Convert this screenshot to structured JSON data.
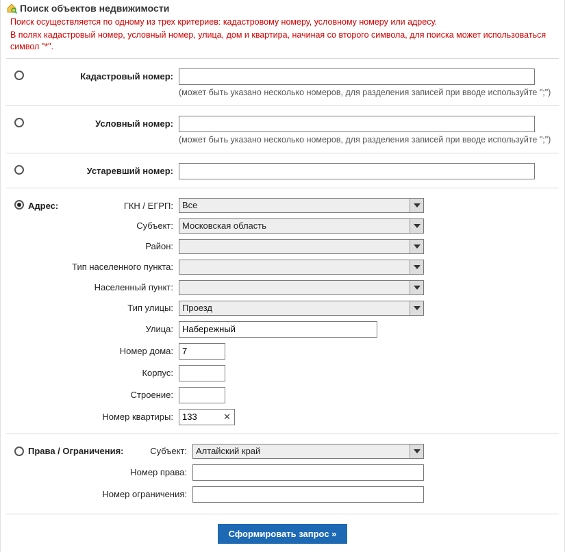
{
  "title": "Поиск объектов недвижимости",
  "note_line1": "Поиск осуществляется по одному из трех критериев: кадастровому номеру, условному номеру или адресу.",
  "note_line2": "В полях кадастровый номер, условный номер, улица, дом и квартира, начиная со второго символа, для поиска может использоваться символ \"*\".",
  "criteria": {
    "cadastral": {
      "label": "Кадастровый номер:",
      "value": "",
      "hint": "(может быть указано несколько номеров, для разделения записей при вводе используйте \";\")"
    },
    "conditional": {
      "label": "Условный номер:",
      "value": "",
      "hint": "(может быть указано несколько номеров, для разделения записей при вводе используйте \";\")"
    },
    "obsolete": {
      "label": "Устаревший номер:",
      "value": ""
    }
  },
  "address": {
    "label": "Адрес:",
    "gkn_label": "ГКН / ЕГРП:",
    "gkn_value": "Все",
    "subject_label": "Субъект:",
    "subject_value": "Московская область",
    "district_label": "Район:",
    "district_value": "",
    "settlement_type_label": "Тип населенного пункта:",
    "settlement_type_value": "",
    "settlement_label": "Населенный пункт:",
    "settlement_value": "",
    "street_type_label": "Тип улицы:",
    "street_type_value": "Проезд",
    "street_label": "Улица:",
    "street_value": "Набережный",
    "house_label": "Номер дома:",
    "house_value": "7",
    "korpus_label": "Корпус:",
    "korpus_value": "",
    "building_label": "Строение:",
    "building_value": "",
    "flat_label": "Номер квартиры:",
    "flat_value": "133"
  },
  "rights": {
    "label": "Права / Ограничения:",
    "subject_label": "Субъект:",
    "subject_value": "Алтайский край",
    "right_no_label": "Номер права:",
    "right_no_value": "",
    "restriction_no_label": "Номер ограничения:",
    "restriction_no_value": ""
  },
  "submit_label": "Сформировать запрос »"
}
